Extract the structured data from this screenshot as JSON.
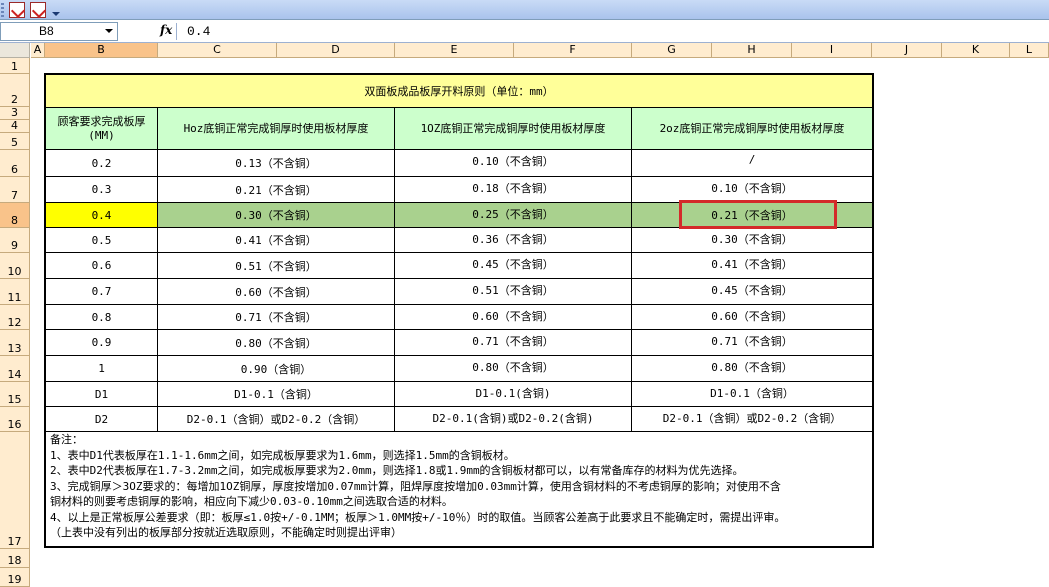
{
  "formula_bar": {
    "name_box": "B8",
    "fx_label": "fx",
    "value": "0.4"
  },
  "columns": [
    "A",
    "B",
    "C",
    "D",
    "E",
    "F",
    "G",
    "H",
    "I",
    "J",
    "K",
    "L"
  ],
  "rows": [
    "1",
    "2",
    "3",
    "4",
    "5",
    "6",
    "7",
    "8",
    "9",
    "10",
    "11",
    "12",
    "13",
    "14",
    "15",
    "16",
    "17",
    "18",
    "19"
  ],
  "table": {
    "title": "双面板成品板厚开料原则（单位：mm）",
    "headers": [
      "顾客要求完成板厚(MM)",
      "Hoz底铜正常完成铜厚时使用板材厚度",
      "1OZ底铜正常完成铜厚时使用板材厚度",
      "2oz底铜正常完成铜厚时使用板材厚度"
    ],
    "data_rows": [
      [
        "0.2",
        "0.13（不含铜）",
        "0.10（不含铜）",
        "/"
      ],
      [
        "0.3",
        "0.21（不含铜）",
        "0.18（不含铜）",
        "0.10（不含铜）"
      ],
      [
        "0.4",
        "0.30（不含铜）",
        "0.25（不含铜）",
        "0.21（不含铜）"
      ],
      [
        "0.5",
        "0.41（不含铜）",
        "0.36（不含铜）",
        "0.30（不含铜）"
      ],
      [
        "0.6",
        "0.51（不含铜）",
        "0.45（不含铜）",
        "0.41（不含铜）"
      ],
      [
        "0.7",
        "0.60（不含铜）",
        "0.51（不含铜）",
        "0.45（不含铜）"
      ],
      [
        "0.8",
        "0.71（不含铜）",
        "0.60（不含铜）",
        "0.60（不含铜）"
      ],
      [
        "0.9",
        "0.80（不含铜）",
        "0.71（不含铜）",
        "0.71（不含铜）"
      ],
      [
        "1",
        "0.90（含铜）",
        "0.80（不含铜）",
        "0.80（不含铜）"
      ],
      [
        "D1",
        "D1-0.1（含铜）",
        "D1-0.1(含铜)",
        "D1-0.1（含铜）"
      ],
      [
        "D2",
        "D2-0.1（含铜）或D2-0.2（含铜）",
        "D2-0.1(含铜)或D2-0.2(含铜)",
        "D2-0.1（含铜）或D2-0.2（含铜）"
      ]
    ],
    "notes": [
      "备注：",
      "   1、表中D1代表板厚在1.1-1.6mm之间，如完成板厚要求为1.6mm，则选择1.5mm的含铜板材。",
      "   2、表中D2代表板厚在1.7-3.2mm之间，如完成板厚要求为2.0mm，则选择1.8或1.9mm的含铜板材都可以，以有常备库存的材料为优先选择。",
      "   3、完成铜厚＞3OZ要求的：每增加1OZ铜厚，厚度按增加0.07mm计算，阻焊厚度按增加0.03mm计算，使用含铜材料的不考虑铜厚的影响；对使用不含",
      "铜材料的则要考虑铜厚的影响，相应向下减少0.03-0.10mm之间选取合适的材料。",
      "   4、以上是正常板厚公差要求（即：板厚≤1.0按+/-0.1MM；板厚＞1.0MM按+/-10％）时的取值。当顾客公差高于此要求且不能确定时，需提出评审。",
      "（上表中没有列出的板厚部分按就近选取原则，不能确定时则提出评审）"
    ]
  },
  "colors": {
    "title_fill": "#ffff99",
    "header_fill": "#ccffcc",
    "selected_row_fill": "#a9d18e",
    "active_cell_fill": "#ffff00",
    "highlight_box": "#d42a2a"
  }
}
